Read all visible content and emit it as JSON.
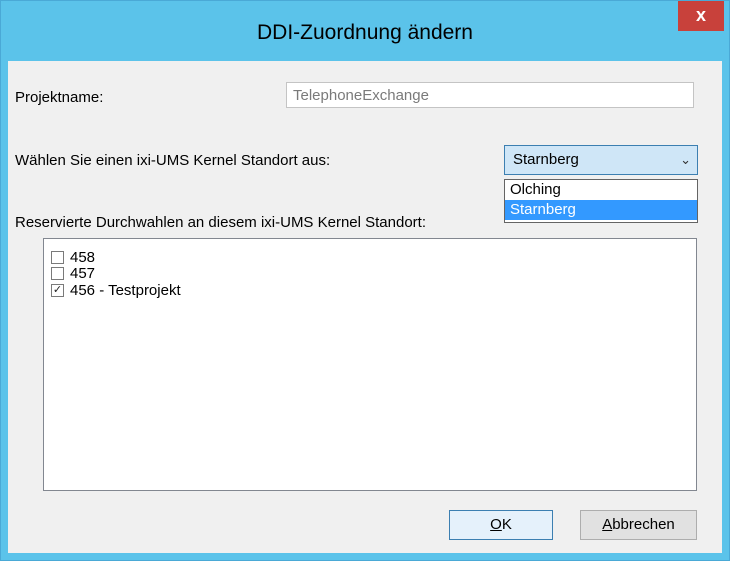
{
  "window": {
    "title": "DDI-Zuordnung ändern",
    "close_glyph": "x"
  },
  "form": {
    "project_label": "Projektname:",
    "project_value": "TelephoneExchange",
    "location_label": "Wählen Sie einen ixi-UMS Kernel Standort aus:",
    "location_selected": "Starnberg",
    "location_options": [
      "Olching",
      "Starnberg"
    ],
    "reserved_label": "Reservierte Durchwahlen an diesem ixi-UMS Kernel Standort:"
  },
  "list": {
    "items": [
      {
        "label": "458",
        "checked": false
      },
      {
        "label": "457",
        "checked": false
      },
      {
        "label": "456 - Testprojekt",
        "checked": true
      }
    ]
  },
  "buttons": {
    "ok_mnemonic": "O",
    "ok_rest": "K",
    "cancel_mnemonic": "A",
    "cancel_rest": "bbrechen"
  },
  "colors": {
    "title_bar": "#5bc3ea",
    "close": "#c8413b",
    "selection": "#3399ff"
  },
  "icons": {
    "close": "close-icon",
    "dropdown": "chevron-down-icon",
    "check": "checkmark-icon"
  }
}
